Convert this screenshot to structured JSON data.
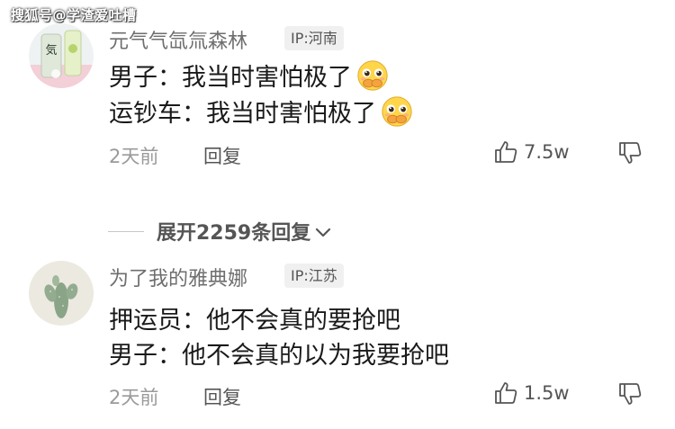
{
  "watermark": "搜狐号@学渣爱吐槽",
  "comments": [
    {
      "username": "元气气氙氚森林",
      "ip": "IP:河南",
      "lines": [
        "男子：我当时害怕极了",
        "运钞车：我当时害怕极了"
      ],
      "time": "2天前",
      "reply_label": "回复",
      "likes": "7.5w",
      "avatar_icon": "drink-bottle-avatar",
      "line_emoji": "covering-mouth-face-emoji"
    },
    {
      "username": "为了我的雅典娜",
      "ip": "IP:江苏",
      "lines": [
        "押运员：他不会真的要抢吧",
        "男子：他不会真的以为我要抢吧"
      ],
      "time": "2天前",
      "reply_label": "回复",
      "likes": "1.5w",
      "avatar_icon": "cactus-avatar"
    }
  ],
  "expand_replies": "展开2259条回复",
  "colors": {
    "username": "#6e6e6e",
    "text": "#1a1a1a",
    "meta": "#9a9a9a",
    "badge_bg": "#f0f0f0"
  }
}
